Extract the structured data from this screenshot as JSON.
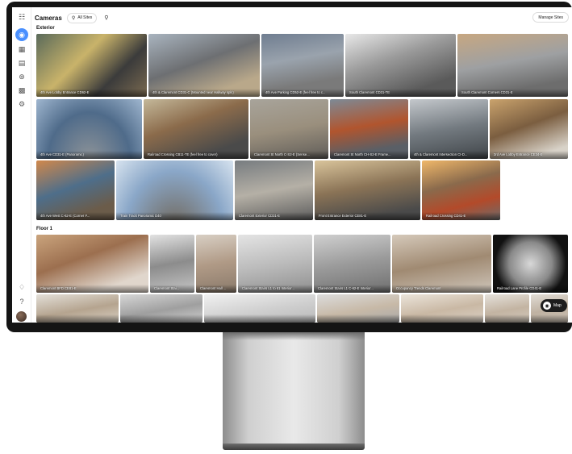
{
  "header": {
    "title": "Cameras",
    "site_filter": "All Sites",
    "manage_label": "Manage Sites"
  },
  "sections": {
    "exterior": "Exterior",
    "floor1": "Floor 1"
  },
  "sidebar": {
    "icons": [
      "grid-menu-icon",
      "camera-icon",
      "dashboard-icon",
      "archive-icon",
      "access-icon",
      "vehicle-icon",
      "settings-icon",
      "bell-icon",
      "help-icon"
    ]
  },
  "map_label": "Map",
  "cameras": [
    {
      "name": "4th Ave Lobby Entrance CD62-E",
      "bg": "linear-gradient(135deg,#5a6a5a,#c9b36a 40%,#3b3b3b 70%,#7a6a50)"
    },
    {
      "name": "4th & Claremont CD31-C (Mounted near Hallway split)",
      "bg": "linear-gradient(160deg,#a9b4bf,#6d6f72 45%,#b9a88a 80%)"
    },
    {
      "name": "4th Ave Parking CD52-E (feel free to c...",
      "bg": "linear-gradient(170deg,#6f7d90,#9aa3ad 40%,#7a7a7a 75%)"
    },
    {
      "name": "South Claremont CD31-TE",
      "bg": "linear-gradient(160deg,#e8e8e8,#9a9a9a 40%,#5a5a5a 80%)"
    },
    {
      "name": "South Claremont Corners CD31-E",
      "bg": "linear-gradient(170deg,#c7a781,#9ea0a2 45%,#6d6d6d 80%)"
    },
    {
      "name": "4th Ave CD31-E (Panoramic)",
      "bg": "radial-gradient(ellipse at 50% 100%,#8d9398,#4f6b8a 55%,#9fb6cf)"
    },
    {
      "name": "Railroad Crossing CB11-TE (feel free to cover)",
      "bg": "linear-gradient(160deg,#c4b89a,#8b6b4b 40%,#4a4a4a 80%)"
    },
    {
      "name": "Claremont St North C-S2-E (Sense...",
      "bg": "linear-gradient(170deg,#a8a49b,#9a8f7d 50%,#5f5c58)"
    },
    {
      "name": "Claremont St North CH-S2-E Frame...",
      "bg": "linear-gradient(170deg,#7d8a96,#b1552e 45%,#5a5f66 80%)"
    },
    {
      "name": "4th & Claremont Intersection CI-D...",
      "bg": "linear-gradient(170deg,#c4c8cc,#737a80 50%,#3f4448)"
    },
    {
      "name": "3rd Ave Lobby Entrance CE34-E",
      "bg": "linear-gradient(160deg,#caa36d,#7b5e40 45%,#d8d2c8 85%)"
    },
    {
      "name": "4th Ave West C-62-E (Corner #...",
      "bg": "linear-gradient(160deg,#d1884b,#4e6e8a 45%,#6b5c4a 80%)"
    },
    {
      "name": "Train Track Panoramic D40",
      "bg": "radial-gradient(ellipse at 50% 120%,#6f6455,#8aa7c8 60%,#d7e3ef)"
    },
    {
      "name": "Claremont Exterior CD31-E",
      "bg": "linear-gradient(170deg,#777c80,#b5b0a6 50%,#5c5c5c)"
    },
    {
      "name": "Front Entrance Exterior CE81-E",
      "bg": "linear-gradient(170deg,#d9c49b,#8a7356 45%,#4a4a4a 85%)"
    },
    {
      "name": "Railroad Crossing CD41-E",
      "bg": "linear-gradient(165deg,#f0b86a,#8a6a4c 40%,#b34a2a 70%,#6b6b6b)"
    },
    {
      "name": "Claremont BFD CE81-E",
      "bg": "linear-gradient(160deg,#caa47d,#9c6f4f 40%,#e0d6cc 80%)"
    },
    {
      "name": "Claremont Stai...",
      "bg": "linear-gradient(170deg,#e2e2e2,#8c8c8c 50%,#c6c6c6)"
    },
    {
      "name": "Claremont Hall ...",
      "bg": "linear-gradient(170deg,#d8cfc4,#b09a86 50%,#8a7a6b)"
    },
    {
      "name": "Claremont Stairs L1 to 61 Interior...",
      "bg": "linear-gradient(170deg,#e4e4e4,#bcbcbc 50%,#8f8f8f)"
    },
    {
      "name": "Claremont Stairs L1 C-62-E Interior...",
      "bg": "linear-gradient(170deg,#d0d0d0,#9a9a9a 50%,#6f6f6f)"
    },
    {
      "name": "Occupancy Trends Claremont",
      "bg": "linear-gradient(170deg,#d5c9ba,#a08a72 50%,#cfc6bb)"
    },
    {
      "name": "Railroad Lane Profile CD41-E",
      "bg": "radial-gradient(circle at 50% 50%,#d8d8d8,#8a8a8a 45%,#111 75%)"
    },
    {
      "name": "",
      "bg": "linear-gradient(170deg,#e3dfd8,#b5a48f 55%,#d8cfc2)"
    },
    {
      "name": "",
      "bg": "linear-gradient(170deg,#d6d6d6,#9f9f9f 55%,#cfcfcf)"
    },
    {
      "name": "",
      "bg": "linear-gradient(170deg,#f1f1f1,#cfcfcf 55%,#b8b8b8)"
    },
    {
      "name": "",
      "bg": "linear-gradient(170deg,#dcdcdc,#c7b9a7 55%,#a9a9a9)"
    },
    {
      "name": "",
      "bg": "linear-gradient(170deg,#ebe4da,#c9b8a4 55%,#dad0c4)"
    },
    {
      "name": "",
      "bg": "linear-gradient(170deg,#e5e1db,#c3b4a2 55%,#d3c9bd)"
    },
    {
      "name": "",
      "bg": "linear-gradient(170deg,#e1dcd5,#bfb2a2 55%,#ccc2b6)"
    }
  ]
}
